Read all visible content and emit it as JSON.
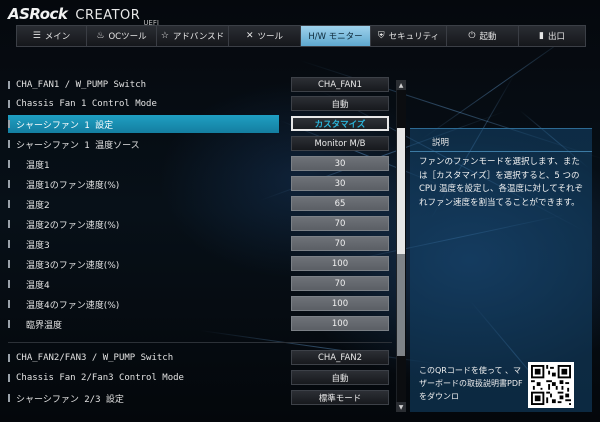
{
  "brand": {
    "name": "ASRock",
    "product": "CREATOR",
    "suffix": "UEFI"
  },
  "nav": {
    "tabs": [
      {
        "label": "メイン",
        "icon": "list-icon",
        "active": false
      },
      {
        "label": "OCツール",
        "icon": "flame-icon",
        "active": false
      },
      {
        "label": "アドバンスド",
        "icon": "star-icon",
        "active": false
      },
      {
        "label": "ツール",
        "icon": "tools-icon",
        "active": false
      },
      {
        "label": "H/W モニター",
        "icon": "",
        "active": true
      },
      {
        "label": "セキュリティ",
        "icon": "shield-icon",
        "active": false
      },
      {
        "label": "起動",
        "icon": "power-icon",
        "active": false
      },
      {
        "label": "出口",
        "icon": "exit-icon",
        "active": false
      }
    ]
  },
  "settings": [
    {
      "label": "CHA_FAN1 / W_PUMP Switch",
      "value": "CHA_FAN1",
      "kind": "combo"
    },
    {
      "label": "Chassis Fan 1 Control Mode",
      "value": "自動",
      "kind": "combo"
    },
    {
      "label": "シャーシファン 1 設定",
      "value": "カスタマイズ",
      "kind": "active"
    },
    {
      "label": "シャーシファン 1 温度ソース",
      "value": "Monitor M/B",
      "kind": "combo"
    },
    {
      "label": "温度1",
      "value": "30",
      "kind": "num"
    },
    {
      "label": "温度1のファン速度(%)",
      "value": "30",
      "kind": "num"
    },
    {
      "label": "温度2",
      "value": "65",
      "kind": "num"
    },
    {
      "label": "温度2のファン速度(%)",
      "value": "70",
      "kind": "num"
    },
    {
      "label": "温度3",
      "value": "70",
      "kind": "num"
    },
    {
      "label": "温度3のファン速度(%)",
      "value": "100",
      "kind": "num"
    },
    {
      "label": "温度4",
      "value": "70",
      "kind": "num"
    },
    {
      "label": "温度4のファン速度(%)",
      "value": "100",
      "kind": "num"
    },
    {
      "label": "臨界温度",
      "value": "100",
      "kind": "num"
    },
    {
      "label": "CHA_FAN2/FAN3 / W_PUMP Switch",
      "value": "CHA_FAN2",
      "kind": "combo"
    },
    {
      "label": "Chassis Fan 2/Fan3 Control Mode",
      "value": "自動",
      "kind": "combo"
    },
    {
      "label": "シャーシファン 2/3 設定",
      "value": "標準モード",
      "kind": "combo"
    }
  ],
  "description": {
    "title": "説明",
    "text": "ファンのファンモードを選択します、または［カスタマイズ］を選択すると、5 つの CPU 温度を設定し、各温度に対してそれぞれファン速度を割当てることができます。",
    "qr_text": "このQRコードを使って 、マザーボードの取扱説明書PDFをダウンロ"
  },
  "colors": {
    "highlight": "#1f9fc3",
    "active_tab": "#7fbfe0",
    "value_accent": "#2bb5da"
  }
}
